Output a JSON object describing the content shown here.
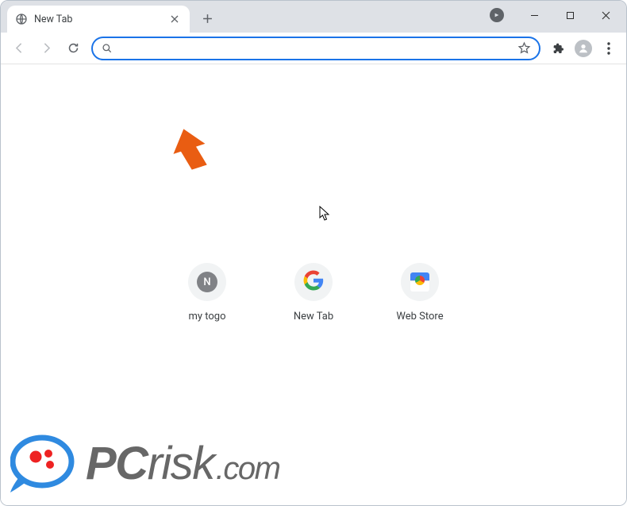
{
  "window": {
    "tab_title": "New Tab"
  },
  "omnibox": {
    "value": "",
    "placeholder": ""
  },
  "shortcuts": [
    {
      "label": "my togo",
      "icon": "letter-n"
    },
    {
      "label": "New Tab",
      "icon": "google-g"
    },
    {
      "label": "Web Store",
      "icon": "webstore"
    }
  ],
  "watermark": {
    "brand_prefix": "PC",
    "brand_suffix": "risk",
    "tld": ".com"
  }
}
